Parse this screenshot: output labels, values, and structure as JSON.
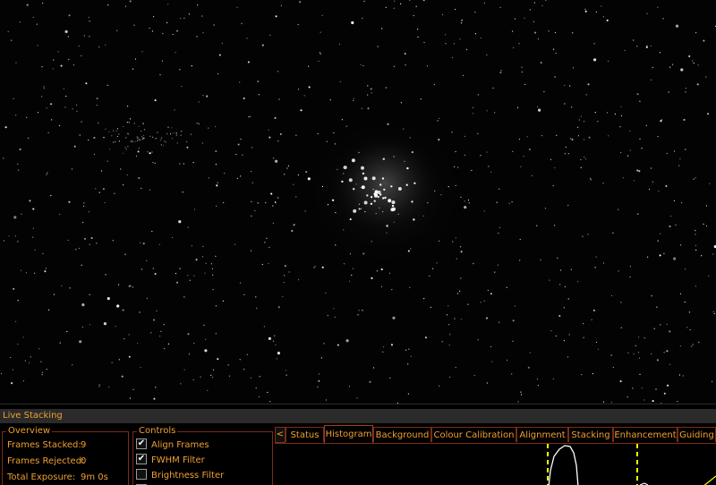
{
  "panel": {
    "title": "Live Stacking"
  },
  "overview": {
    "legend": "Overview",
    "rows": [
      {
        "label": "Frames Stacked:",
        "value": "9"
      },
      {
        "label": "Frames Rejected:",
        "value": "0"
      },
      {
        "label": "Total Exposure:",
        "value": "9m 0s"
      }
    ]
  },
  "controls": {
    "legend": "Controls",
    "items": [
      {
        "label": "Align Frames",
        "checked": true
      },
      {
        "label": "FWHM Filter",
        "checked": true
      },
      {
        "label": "Brightness Filter",
        "checked": false
      }
    ]
  },
  "tabs": {
    "scroll_left": "<",
    "items": [
      "Status",
      "Histogram",
      "Background",
      "Colour Calibration",
      "Alignment",
      "Stacking",
      "Enhancement",
      "Guiding"
    ],
    "active": "Histogram"
  },
  "colors": {
    "accent": "#f0a030",
    "border": "#7a2e12",
    "marker": "#ffff00"
  }
}
